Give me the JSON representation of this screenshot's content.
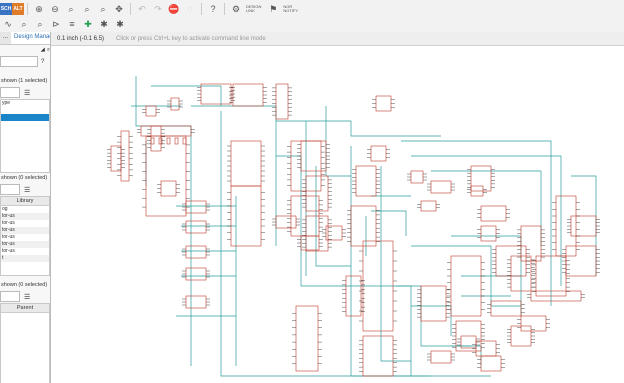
{
  "toolbar": {
    "badge_sch": "SCH",
    "badge_alt": "ALT",
    "design_link_label": "DESIGN\nLINK",
    "nor_notify_label": "NOR\nNOTIFY"
  },
  "left_panel": {
    "tab_prev": "...",
    "tab_design_manager": "Design Manager",
    "section1_text": "shown (1 selected)",
    "type_label": "ype",
    "section2_text": "shown (0 selected)",
    "library_header": "Library",
    "library_rows": [
      "og",
      "tor-us",
      "tor-us",
      "tor-us",
      "tor-us",
      "tor-us",
      "tor-us",
      "t"
    ],
    "section3_text": "shown (0 selected)",
    "parent_header": "Parent"
  },
  "canvas": {
    "coords": "0.1 inch (-0.1 6.5)",
    "hint": "Click or press Ctrl+L key to activate command line mode"
  },
  "colors": {
    "wire": "#2a9d9d",
    "component": "#c0392b",
    "net_label": "#222222",
    "selection": "#1a86c8"
  }
}
